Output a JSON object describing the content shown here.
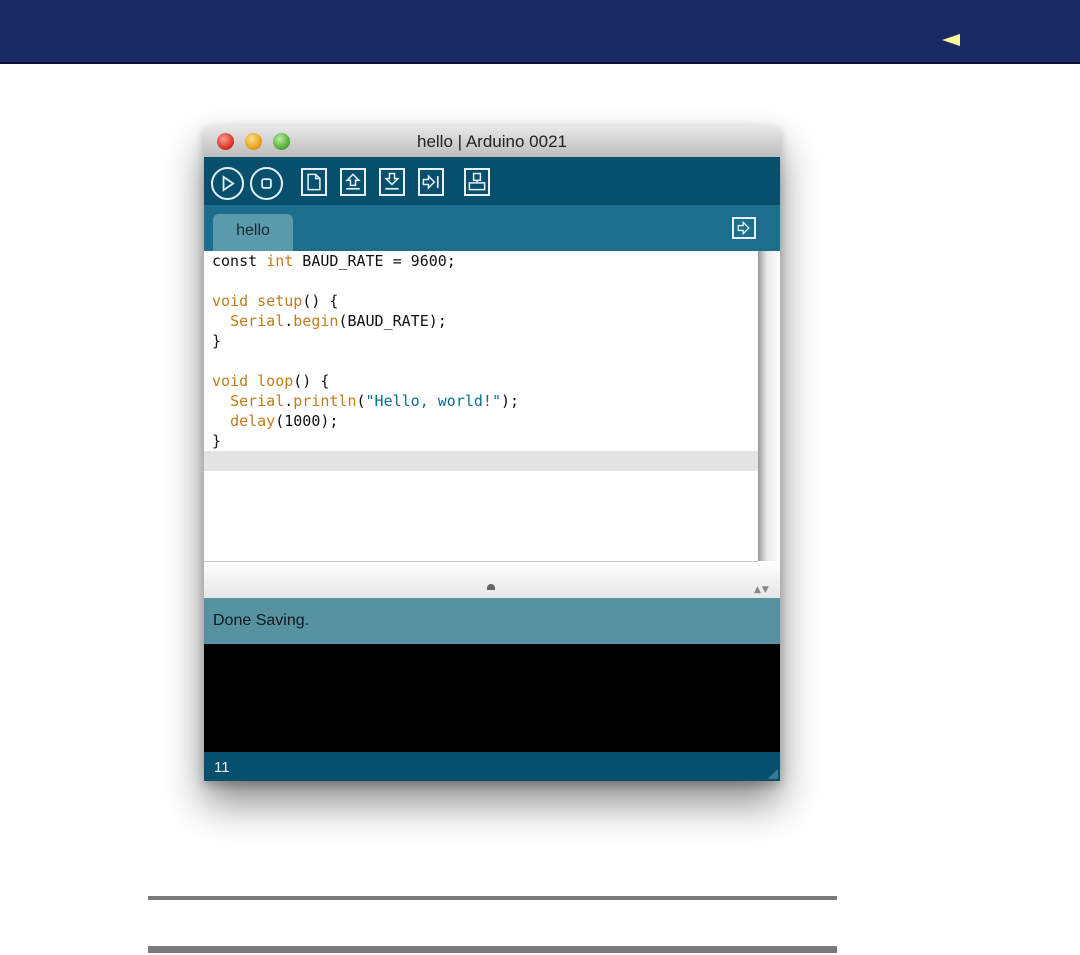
{
  "window": {
    "title": "hello | Arduino 0021"
  },
  "toolbar": {
    "buttons": [
      {
        "name": "verify",
        "icon": "play-icon"
      },
      {
        "name": "stop",
        "icon": "stop-icon"
      },
      {
        "name": "new",
        "icon": "new-file-icon"
      },
      {
        "name": "open",
        "icon": "open-arrow-up-icon"
      },
      {
        "name": "save",
        "icon": "save-arrow-down-icon"
      },
      {
        "name": "upload",
        "icon": "upload-arrow-right-icon"
      },
      {
        "name": "serial-monitor",
        "icon": "serial-monitor-icon"
      }
    ]
  },
  "tabs": [
    {
      "label": "hello",
      "active": true
    }
  ],
  "editor": {
    "lines": [
      "const int BAUD_RATE = 9600;",
      "",
      "void setup() {",
      "  Serial.begin(BAUD_RATE);",
      "}",
      "",
      "void loop() {",
      "  Serial.println(\"Hello, world!\");",
      "  delay(1000);",
      "}"
    ]
  },
  "status": {
    "message": "Done Saving."
  },
  "footer": {
    "line_number": "11"
  },
  "colors": {
    "header_bar": "#1a2a64",
    "toolbar": "#06506e",
    "tabbar": "#1b6e8c",
    "status": "#5792a0",
    "keyword": "#c27c1a",
    "string": "#0a6e8f",
    "back_arrow": "#fff79a"
  }
}
